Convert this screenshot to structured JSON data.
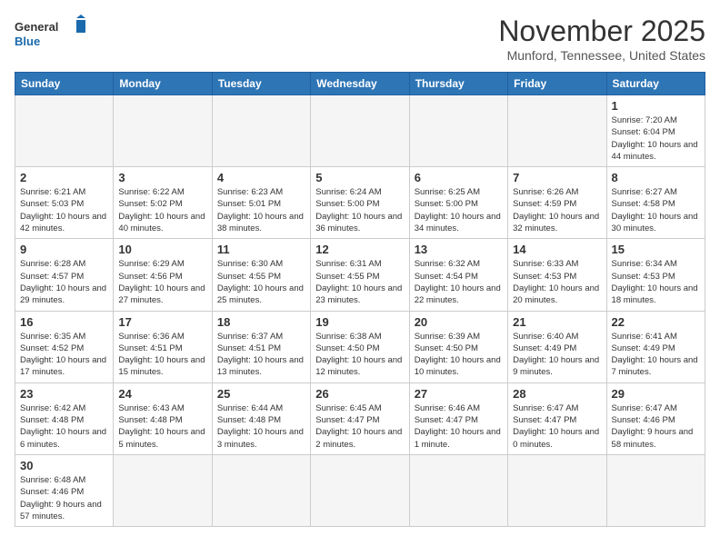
{
  "header": {
    "logo_general": "General",
    "logo_blue": "Blue",
    "month": "November 2025",
    "location": "Munford, Tennessee, United States"
  },
  "days_of_week": [
    "Sunday",
    "Monday",
    "Tuesday",
    "Wednesday",
    "Thursday",
    "Friday",
    "Saturday"
  ],
  "weeks": [
    [
      {
        "day": "",
        "info": ""
      },
      {
        "day": "",
        "info": ""
      },
      {
        "day": "",
        "info": ""
      },
      {
        "day": "",
        "info": ""
      },
      {
        "day": "",
        "info": ""
      },
      {
        "day": "",
        "info": ""
      },
      {
        "day": "1",
        "info": "Sunrise: 7:20 AM\nSunset: 6:04 PM\nDaylight: 10 hours and 44 minutes."
      }
    ],
    [
      {
        "day": "2",
        "info": "Sunrise: 6:21 AM\nSunset: 5:03 PM\nDaylight: 10 hours and 42 minutes."
      },
      {
        "day": "3",
        "info": "Sunrise: 6:22 AM\nSunset: 5:02 PM\nDaylight: 10 hours and 40 minutes."
      },
      {
        "day": "4",
        "info": "Sunrise: 6:23 AM\nSunset: 5:01 PM\nDaylight: 10 hours and 38 minutes."
      },
      {
        "day": "5",
        "info": "Sunrise: 6:24 AM\nSunset: 5:00 PM\nDaylight: 10 hours and 36 minutes."
      },
      {
        "day": "6",
        "info": "Sunrise: 6:25 AM\nSunset: 5:00 PM\nDaylight: 10 hours and 34 minutes."
      },
      {
        "day": "7",
        "info": "Sunrise: 6:26 AM\nSunset: 4:59 PM\nDaylight: 10 hours and 32 minutes."
      },
      {
        "day": "8",
        "info": "Sunrise: 6:27 AM\nSunset: 4:58 PM\nDaylight: 10 hours and 30 minutes."
      }
    ],
    [
      {
        "day": "9",
        "info": "Sunrise: 6:28 AM\nSunset: 4:57 PM\nDaylight: 10 hours and 29 minutes."
      },
      {
        "day": "10",
        "info": "Sunrise: 6:29 AM\nSunset: 4:56 PM\nDaylight: 10 hours and 27 minutes."
      },
      {
        "day": "11",
        "info": "Sunrise: 6:30 AM\nSunset: 4:55 PM\nDaylight: 10 hours and 25 minutes."
      },
      {
        "day": "12",
        "info": "Sunrise: 6:31 AM\nSunset: 4:55 PM\nDaylight: 10 hours and 23 minutes."
      },
      {
        "day": "13",
        "info": "Sunrise: 6:32 AM\nSunset: 4:54 PM\nDaylight: 10 hours and 22 minutes."
      },
      {
        "day": "14",
        "info": "Sunrise: 6:33 AM\nSunset: 4:53 PM\nDaylight: 10 hours and 20 minutes."
      },
      {
        "day": "15",
        "info": "Sunrise: 6:34 AM\nSunset: 4:53 PM\nDaylight: 10 hours and 18 minutes."
      }
    ],
    [
      {
        "day": "16",
        "info": "Sunrise: 6:35 AM\nSunset: 4:52 PM\nDaylight: 10 hours and 17 minutes."
      },
      {
        "day": "17",
        "info": "Sunrise: 6:36 AM\nSunset: 4:51 PM\nDaylight: 10 hours and 15 minutes."
      },
      {
        "day": "18",
        "info": "Sunrise: 6:37 AM\nSunset: 4:51 PM\nDaylight: 10 hours and 13 minutes."
      },
      {
        "day": "19",
        "info": "Sunrise: 6:38 AM\nSunset: 4:50 PM\nDaylight: 10 hours and 12 minutes."
      },
      {
        "day": "20",
        "info": "Sunrise: 6:39 AM\nSunset: 4:50 PM\nDaylight: 10 hours and 10 minutes."
      },
      {
        "day": "21",
        "info": "Sunrise: 6:40 AM\nSunset: 4:49 PM\nDaylight: 10 hours and 9 minutes."
      },
      {
        "day": "22",
        "info": "Sunrise: 6:41 AM\nSunset: 4:49 PM\nDaylight: 10 hours and 7 minutes."
      }
    ],
    [
      {
        "day": "23",
        "info": "Sunrise: 6:42 AM\nSunset: 4:48 PM\nDaylight: 10 hours and 6 minutes."
      },
      {
        "day": "24",
        "info": "Sunrise: 6:43 AM\nSunset: 4:48 PM\nDaylight: 10 hours and 5 minutes."
      },
      {
        "day": "25",
        "info": "Sunrise: 6:44 AM\nSunset: 4:48 PM\nDaylight: 10 hours and 3 minutes."
      },
      {
        "day": "26",
        "info": "Sunrise: 6:45 AM\nSunset: 4:47 PM\nDaylight: 10 hours and 2 minutes."
      },
      {
        "day": "27",
        "info": "Sunrise: 6:46 AM\nSunset: 4:47 PM\nDaylight: 10 hours and 1 minute."
      },
      {
        "day": "28",
        "info": "Sunrise: 6:47 AM\nSunset: 4:47 PM\nDaylight: 10 hours and 0 minutes."
      },
      {
        "day": "29",
        "info": "Sunrise: 6:47 AM\nSunset: 4:46 PM\nDaylight: 9 hours and 58 minutes."
      }
    ],
    [
      {
        "day": "30",
        "info": "Sunrise: 6:48 AM\nSunset: 4:46 PM\nDaylight: 9 hours and 57 minutes."
      },
      {
        "day": "",
        "info": ""
      },
      {
        "day": "",
        "info": ""
      },
      {
        "day": "",
        "info": ""
      },
      {
        "day": "",
        "info": ""
      },
      {
        "day": "",
        "info": ""
      },
      {
        "day": "",
        "info": ""
      }
    ]
  ]
}
